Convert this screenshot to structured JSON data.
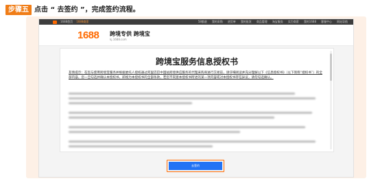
{
  "step": {
    "badge": "步骤五",
    "instruction": "点击 “ 去签约 ”，完成签约流程。"
  },
  "browser": {
    "topbar": {
      "left_items": [
        "1688首页",
        "1688商家"
      ],
      "right_items": [
        "58都退",
        "我的采购",
        "进货单",
        "我的批发",
        "商品管理",
        "淘宝服务",
        "实力商家",
        "我的1688",
        "客服中心",
        "网站导航"
      ]
    },
    "header": {
      "logo": "1688",
      "brand_title": "跨境专供  跨境宝",
      "brand_url": "kj.1688.com"
    },
    "document": {
      "title": "跨境宝服务信息授权书",
      "notice": "友情提示：在您与使用跨境宝服务并根据委托人授权通过阿里巴巴中国站跨境供应服务的代理采购商进行交易前，请仔细阅读并充分理解以下《信息授权书》（以下简称“授权书”）的全部内容。您一旦勾选并确认本授权书，即视为本授权书的全部条款，若您不同意本授权书所述的某一项内容或对本授权书存在异议，请勿勾选确认。"
    },
    "sign_button_label": "去签约"
  },
  "colors": {
    "accent_orange": "#f07d17",
    "brand_orange": "#ff6a00",
    "button_blue": "#2273f5",
    "frame_bg": "#fdf0e6"
  }
}
